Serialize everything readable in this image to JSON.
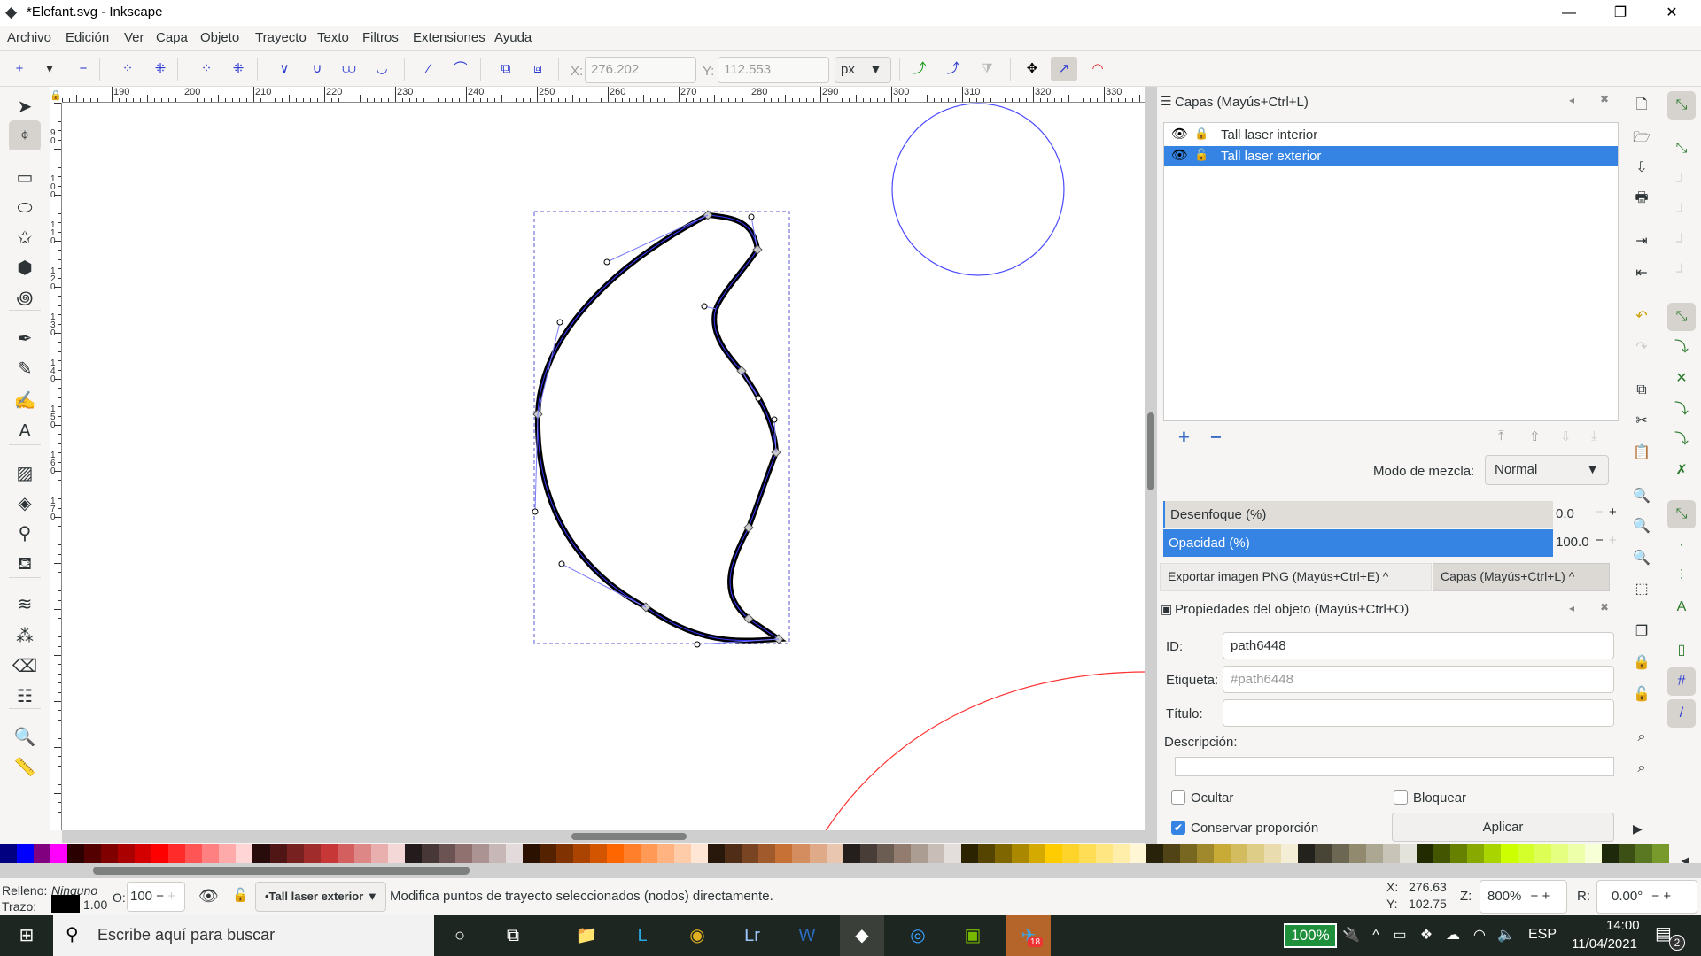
{
  "window": {
    "title": "*Elefant.svg - Inkscape",
    "minimize": "—",
    "maximize": "❐",
    "close": "✕"
  },
  "menu": [
    "Archivo",
    "Edición",
    "Ver",
    "Capa",
    "Objeto",
    "Trayecto",
    "Texto",
    "Filtros",
    "Extensiones",
    "Ayuda"
  ],
  "toolbar": {
    "node_buttons": [
      "insert-node",
      "dropdown",
      "delete-node",
      "join-nodes",
      "break-path",
      "join-segment",
      "delete-segment",
      "make-cusp",
      "make-smooth",
      "make-symmetric",
      "make-auto-smooth",
      "make-line",
      "make-curve",
      "object-to-path",
      "stroke-to-path"
    ],
    "x_label": "X:",
    "x_value": "276.202",
    "y_label": "Y:",
    "y_value": "112.553",
    "unit": "px",
    "extra_buttons": [
      "next-path-effect",
      "path-clip-edit",
      "path-mask-edit",
      "show-transform-handles",
      "show-handles",
      "show-path-outline"
    ]
  },
  "ruler": {
    "h_labels": [
      "190",
      "200",
      "210",
      "220",
      "230",
      "240",
      "250",
      "260",
      "270",
      "280",
      "290",
      "300",
      "310",
      "320",
      "330"
    ],
    "v_labels": [
      "9\n0",
      "1\n0\n0",
      "1\n1\n0",
      "1\n2\n0",
      "1\n3\n0",
      "1\n4\n0",
      "1\n5\n0",
      "1\n6\n0",
      "1\n7\n0"
    ]
  },
  "tools": [
    "selector",
    "node",
    "rect",
    "ellipse",
    "star",
    "3dbox",
    "spiral",
    "bezier",
    "pencil",
    "calligraphy",
    "text",
    "gradient",
    "mesh",
    "dropper",
    "paint-bucket",
    "tweak",
    "spray",
    "eraser",
    "connector",
    "zoom",
    "measure"
  ],
  "layers": {
    "title": "Capas (Mayús+Ctrl+L)",
    "items": [
      {
        "name": "Tall laser  interior",
        "visible": true,
        "locked": true,
        "selected": false
      },
      {
        "name": "Tall laser exterior",
        "visible": true,
        "locked": false,
        "selected": true
      }
    ],
    "blend_label": "Modo de mezcla:",
    "blend_value": "Normal",
    "blur_label": "Desenfoque (%)",
    "blur_value": "0.0",
    "opacity_label": "Opacidad (%)",
    "opacity_value": "100.0"
  },
  "dock_tabs": [
    "Exportar imagen PNG (Mayús+Ctrl+E)",
    "Capas (Mayús+Ctrl+L)"
  ],
  "properties": {
    "title": "Propiedades del objeto (Mayús+Ctrl+O)",
    "id_label": "ID:",
    "id_value": "path6448",
    "label_label": "Etiqueta:",
    "label_placeholder": "#path6448",
    "title_label": "Título:",
    "title_value": "",
    "desc_label": "Descripción:",
    "hide_label": "Ocultar",
    "hide_checked": false,
    "lock_label": "Bloquear",
    "lock_checked": false,
    "ratio_label": "Conservar proporción",
    "ratio_checked": true,
    "apply_label": "Aplicar"
  },
  "palette": [
    "#000080",
    "#0000ff",
    "#800080",
    "#ff00ff",
    "#2b0000",
    "#550000",
    "#800000",
    "#aa0000",
    "#d40000",
    "#ff0000",
    "#ff2a2a",
    "#ff5555",
    "#ff8080",
    "#ffaaaa",
    "#ffd5d5",
    "#280b0b",
    "#501616",
    "#782121",
    "#a02c2c",
    "#c83737",
    "#d35f5f",
    "#de8787",
    "#e9afaf",
    "#f4d7d7",
    "#241c1c",
    "#483737",
    "#6c5353",
    "#917070",
    "#ac9393",
    "#c8b7b7",
    "#e3dbdb",
    "#2b1100",
    "#552200",
    "#803300",
    "#aa4400",
    "#d45500",
    "#ff6600",
    "#ff7f2a",
    "#ff9955",
    "#ffb380",
    "#ffccaa",
    "#ffe6d5",
    "#28170b",
    "#502d16",
    "#784421",
    "#a05a2c",
    "#c87137",
    "#d38d5f",
    "#deaa87",
    "#e9c6af",
    "#241f1c",
    "#483e37",
    "#6c5d53",
    "#917c6f",
    "#ac9d93",
    "#c8beb7",
    "#e3dedb",
    "#2b2200",
    "#554400",
    "#806600",
    "#aa8800",
    "#d4aa00",
    "#ffcc00",
    "#ffd42a",
    "#ffdd55",
    "#ffe680",
    "#ffeeaa",
    "#fff6d5",
    "#28220b",
    "#504416",
    "#786721",
    "#a0892c",
    "#c8ab37",
    "#d3bc5f",
    "#decd87",
    "#e9ddaf",
    "#f4eed7",
    "#24221c",
    "#484537",
    "#6c6753",
    "#918a6f",
    "#aca793",
    "#c8c4b7",
    "#e3e2db",
    "#222b00",
    "#445500",
    "#668000",
    "#88aa00",
    "#aad400",
    "#ccff00",
    "#d4ff2a",
    "#ddff55",
    "#e5ff80",
    "#eeffaa",
    "#f6ffd5",
    "#1e280b",
    "#3c5016",
    "#5a7821",
    "#789a2c"
  ],
  "status": {
    "fill_label": "Relleno:",
    "fill_value": "Ninguno",
    "stroke_label": "Trazo:",
    "stroke_width": "1.00",
    "stroke_color": "#000000",
    "opacity_label": "O:",
    "opacity_value": "100",
    "layer": "•Tall laser exterior",
    "message": "Modifica puntos de trayecto seleccionados (nodos) directamente.",
    "x_label": "X:",
    "x_value": "276.63",
    "y_label": "Y:",
    "y_value": "102.75",
    "zoom_label": "Z:",
    "zoom_value": "800%",
    "rotate_label": "R:",
    "rotate_value": "0.00°"
  },
  "taskbar": {
    "search_placeholder": "Escribe aquí para buscar",
    "apps": [
      "cortana",
      "task-view",
      "file-explorer",
      "lingo",
      "chrome",
      "lightroom",
      "word",
      "inkscape",
      "app-blue",
      "nvidia",
      "telegram"
    ],
    "telegram_badge": "18",
    "battery": "100%",
    "language": "ESP",
    "time": "14:00",
    "date": "11/04/2021",
    "notifications": "2"
  },
  "colors": {
    "accent": "#3584e4",
    "selection": "#4a4aff",
    "canvas_circle": "#4a4aff",
    "red_arc": "#ff3030"
  }
}
